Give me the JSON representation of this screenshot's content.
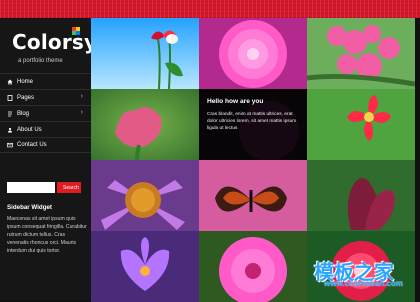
{
  "brand": {
    "logo_text": "Colorsy",
    "tagline": "a portfolio theme"
  },
  "nav": {
    "items": [
      {
        "label": "Home",
        "icon": "home-icon"
      },
      {
        "label": "Pages",
        "icon": "pages-icon"
      },
      {
        "label": "Blog",
        "icon": "blog-icon"
      },
      {
        "label": "About Us",
        "icon": "about-icon"
      },
      {
        "label": "Contact Us",
        "icon": "contact-icon"
      }
    ]
  },
  "search": {
    "placeholder": "",
    "button_label": "Search"
  },
  "widget": {
    "title": "Sidebar Widget",
    "text": "Maecenas sit amet ipsum quis ipsum consequat fringilla. Curabitur rutrum dictum tellus. Cras venenatis rhoncus orci. Mauris interdum dui quis tortor."
  },
  "hover": {
    "title": "Hello how are you",
    "text": "Cras blandit, enim at mattis ultrices, erat dolor ultricies lorem, sit amet mattis ipsum ligula ut lectus"
  },
  "watermark": {
    "text": "模板之家",
    "url": "www.cssmoban.com"
  },
  "colors": {
    "accent": "#d6152a",
    "sidebar": "#161616",
    "search_button": "#e01b24"
  }
}
